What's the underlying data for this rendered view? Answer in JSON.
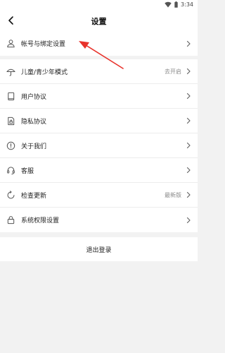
{
  "status_bar": {
    "time": "3:34",
    "wifi_icon": "wifi-icon",
    "battery_icon": "battery-icon"
  },
  "header": {
    "title": "设置",
    "back_icon": "back-arrow-icon"
  },
  "section1": {
    "items": [
      {
        "label": "帐号与绑定设置",
        "icon": "person-icon",
        "value": ""
      }
    ]
  },
  "section2": {
    "items": [
      {
        "label": "儿童/青少年模式",
        "icon": "umbrella-icon",
        "value": "去开启"
      },
      {
        "label": "用户协议",
        "icon": "book-icon",
        "value": ""
      },
      {
        "label": "隐私协议",
        "icon": "document-lock-icon",
        "value": ""
      },
      {
        "label": "关于我们",
        "icon": "info-icon",
        "value": ""
      },
      {
        "label": "客服",
        "icon": "headset-icon",
        "value": ""
      },
      {
        "label": "检查更新",
        "icon": "refresh-icon",
        "value": "最新版"
      },
      {
        "label": "系统权限设置",
        "icon": "lock-icon",
        "value": ""
      }
    ]
  },
  "logout_label": "退出登录",
  "colors": {
    "annotation_arrow": "#e8322b",
    "background": "#f2f2f2",
    "card": "#ffffff"
  }
}
